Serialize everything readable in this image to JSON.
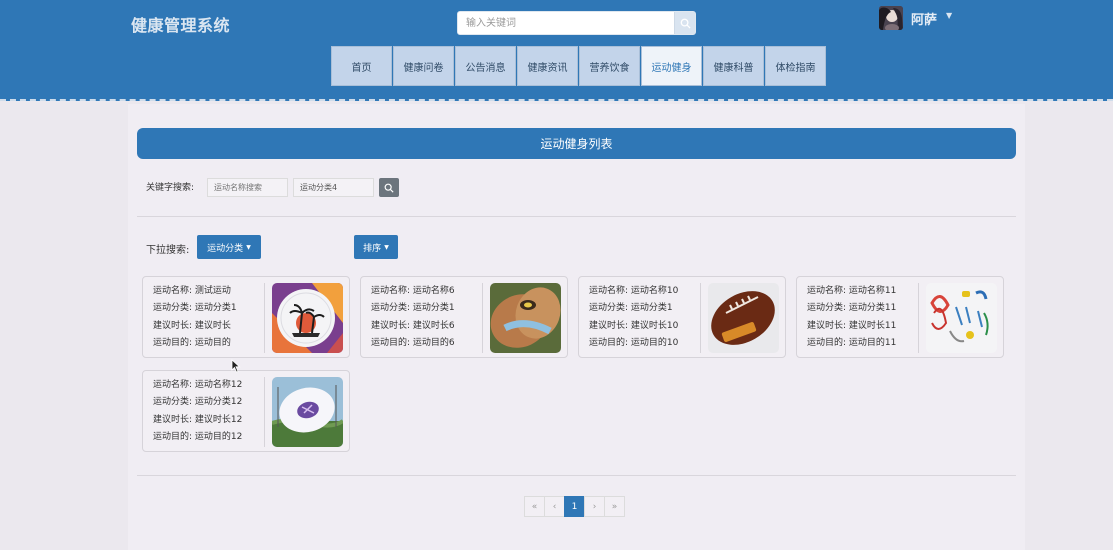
{
  "header": {
    "brand": "健康管理系统",
    "search_placeholder": "输入关键词",
    "username": "阿萨",
    "colors": {
      "primary": "#2f77b6",
      "nav_bg": "#c3d4ea"
    }
  },
  "nav": {
    "items": [
      {
        "label": "首页"
      },
      {
        "label": "健康问卷"
      },
      {
        "label": "公告消息"
      },
      {
        "label": "健康资讯"
      },
      {
        "label": "营养饮食"
      },
      {
        "label": "运动健身"
      },
      {
        "label": "健康科普"
      },
      {
        "label": "体检指南"
      }
    ],
    "active_index": 5
  },
  "main": {
    "title": "运动健身列表",
    "keyword_label": "关键字搜索:",
    "name_placeholder": "运动名称搜索",
    "category_value": "运动分类4",
    "dropdown_label": "下拉搜索:",
    "category_button": "运动分类",
    "sort_button": "排序"
  },
  "cards": [
    {
      "name": "运动名称: 测试运动",
      "category": "运动分类: 运动分类1",
      "duration": "建议时长: 建议时长",
      "purpose": "运动目的: 运动目的",
      "image": "frisbee-palm-image"
    },
    {
      "name": "运动名称: 运动名称6",
      "category": "运动分类: 运动分类1",
      "duration": "建议时长: 建议时长6",
      "purpose": "运动目的: 运动目的6",
      "image": "football-image"
    },
    {
      "name": "运动名称: 运动名称10",
      "category": "运动分类: 运动分类1",
      "duration": "建议时长: 建议时长10",
      "purpose": "运动目的: 运动目的10",
      "image": "american-football-image"
    },
    {
      "name": "运动名称: 运动名称11",
      "category": "运动分类: 运动分类11",
      "duration": "建议时长: 建议时长11",
      "purpose": "运动目的: 运动目的11",
      "image": "climbing-gear-image"
    },
    {
      "name": "运动名称: 运动名称12",
      "category": "运动分类: 运动分类12",
      "duration": "建议时长: 建议时长12",
      "purpose": "运动目的: 运动目的12",
      "image": "frisbee-field-image"
    }
  ],
  "pagination": {
    "first": "«",
    "prev": "‹",
    "current": "1",
    "next": "›",
    "last": "»"
  }
}
